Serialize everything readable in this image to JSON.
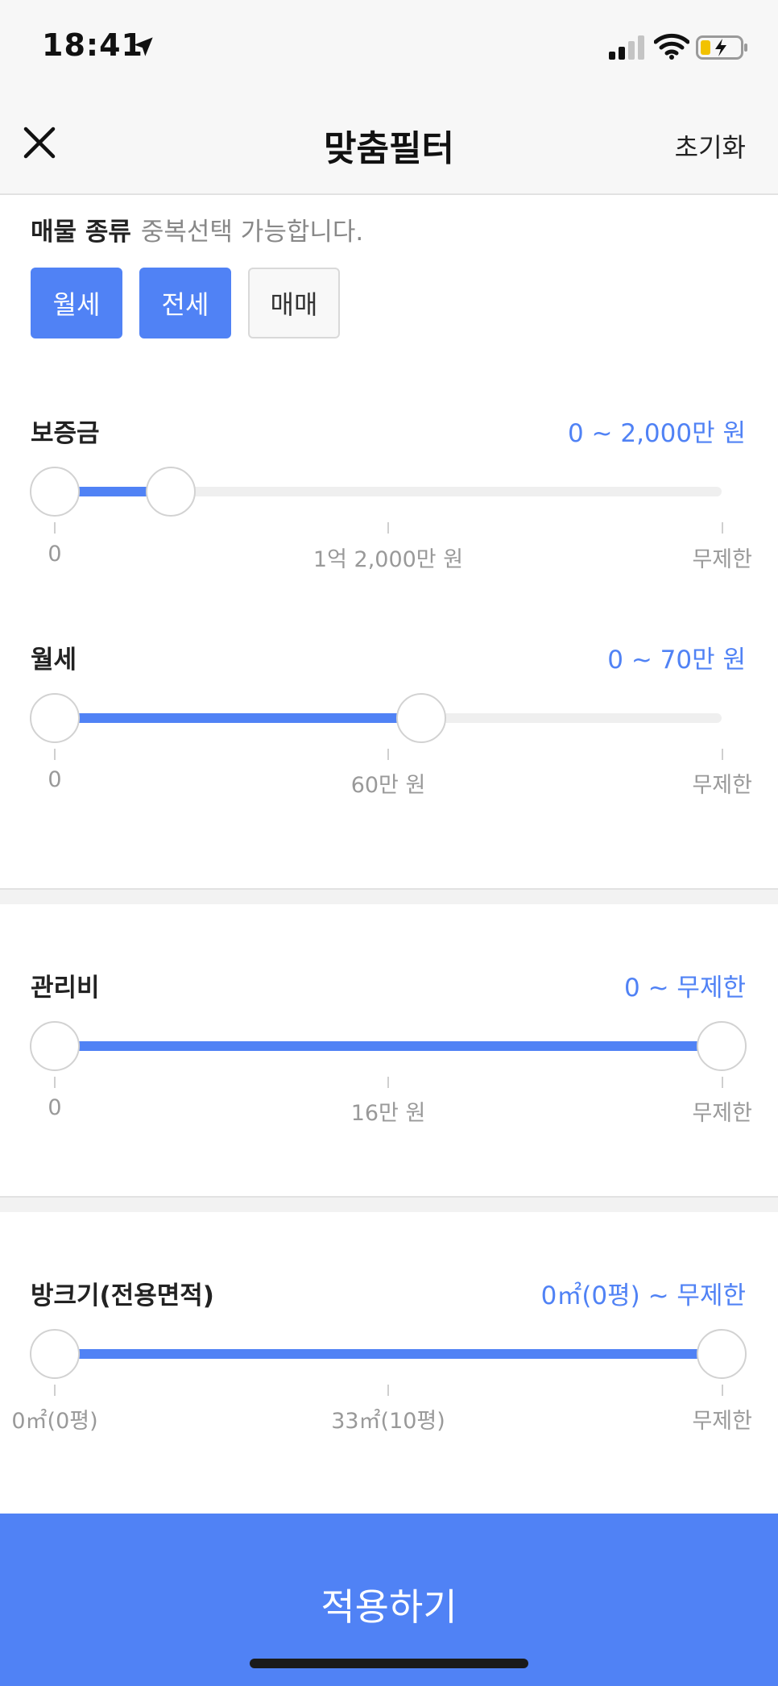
{
  "status_bar": {
    "time": "18:41"
  },
  "nav": {
    "title": "맞춤필터",
    "reset_label": "초기화"
  },
  "property_type": {
    "label": "매물 종류",
    "hint": "중복선택 가능합니다.",
    "options": [
      {
        "label": "월세",
        "selected": true
      },
      {
        "label": "전세",
        "selected": true
      },
      {
        "label": "매매",
        "selected": false
      }
    ]
  },
  "deposit": {
    "label": "보증금",
    "value": "0 ~ 2,000만 원",
    "range": {
      "low": 0,
      "high": 0.174
    },
    "ticks": [
      "0",
      "1억 2,000만 원",
      "무제한"
    ]
  },
  "monthly_rent": {
    "label": "월세",
    "value": "0 ~ 70만 원",
    "range": {
      "low": 0,
      "high": 0.549
    },
    "ticks": [
      "0",
      "60만 원",
      "무제한"
    ]
  },
  "maintenance_fee": {
    "label": "관리비",
    "value": "0 ~ 무제한",
    "range": {
      "low": 0,
      "high": 1
    },
    "ticks": [
      "0",
      "16만 원",
      "무제한"
    ]
  },
  "room_size": {
    "label": "방크기(전용면적)",
    "value": "0㎡(0평) ~ 무제한",
    "range": {
      "low": 0,
      "high": 1
    },
    "ticks": [
      "0㎡(0평)",
      "33㎡(10평)",
      "무제한"
    ]
  },
  "apply_label": "적용하기",
  "colors": {
    "accent": "#5082f5"
  }
}
